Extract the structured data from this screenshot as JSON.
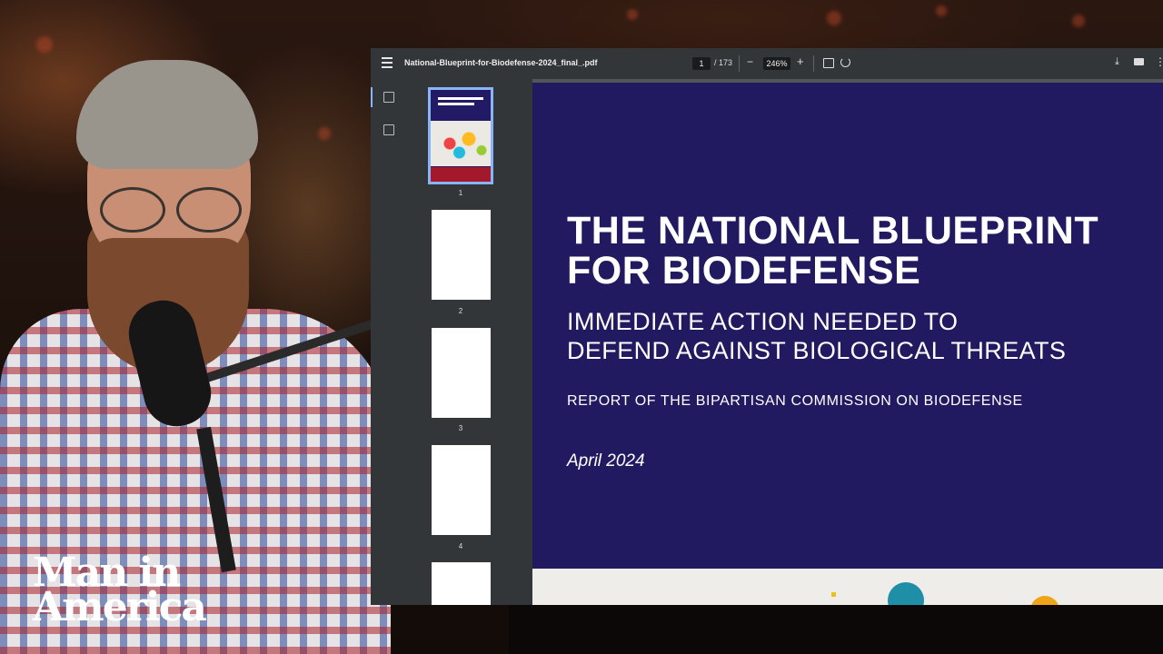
{
  "viewer": {
    "file_name": "National-Blueprint-for-Biodefense-2024_final_.pdf",
    "current_page": "1",
    "total_pages": "/ 173",
    "zoom": "246%",
    "zoom_out_symbol": "−",
    "zoom_in_symbol": "+",
    "more_symbol": "⋮",
    "download_symbol": "⤓"
  },
  "thumbnails": [
    {
      "number": "1",
      "selected": true
    },
    {
      "number": "2",
      "selected": false
    },
    {
      "number": "3",
      "selected": false
    },
    {
      "number": "4",
      "selected": false
    }
  ],
  "document": {
    "title_line1": "THE NATIONAL BLUEPRINT",
    "title_line2": "FOR BIODEFENSE",
    "subtitle_line1": "IMMEDIATE ACTION NEEDED TO",
    "subtitle_line2": "DEFEND AGAINST BIOLOGICAL THREATS",
    "report_line": "REPORT OF THE BIPARTISAN COMMISSION ON BIODEFENSE",
    "date": "April 2024"
  },
  "logo": {
    "line1": "Man in",
    "line2": "America"
  },
  "colors": {
    "cover_background": "#221a60",
    "toolbar": "#323639",
    "selection": "#8ab4f8"
  }
}
